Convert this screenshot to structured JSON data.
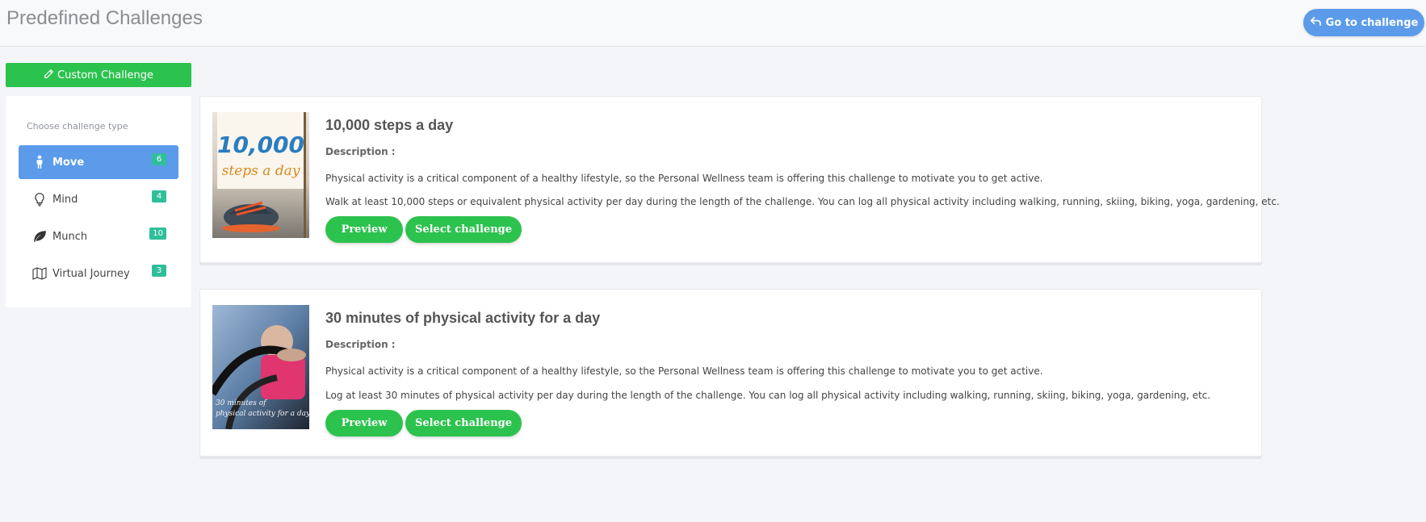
{
  "header": {
    "title": "Predefined Challenges",
    "goto_label": "Go to challenge"
  },
  "custom_challenge_label": "Custom Challenge",
  "sidebar": {
    "heading": "Choose challenge type",
    "items": [
      {
        "label": "Move",
        "count": "6",
        "icon": "person-icon",
        "active": true
      },
      {
        "label": "Mind",
        "count": "4",
        "icon": "lightbulb-icon",
        "active": false
      },
      {
        "label": "Munch",
        "count": "10",
        "icon": "leaf-icon",
        "active": false
      },
      {
        "label": "Virtual Journey",
        "count": "3",
        "icon": "map-icon",
        "active": false
      }
    ]
  },
  "challenges": [
    {
      "title": "10,000 steps a day",
      "desc_label": "Description :",
      "line1": "Physical activity is a critical component of a healthy lifestyle, so the Personal Wellness team is offering this challenge to motivate you to get active.",
      "line2": "Walk at least 10,000 steps or equivalent physical activity per day during the length of the challenge. You can log all physical activity including walking, running, skiing, biking, yoga, gardening, etc.",
      "image_text_1": "10,000",
      "image_text_2": "steps a day",
      "preview_label": "Preview",
      "select_label": "Select challenge"
    },
    {
      "title": "30 minutes of physical activity for a day",
      "desc_label": "Description :",
      "line1": "Physical activity is a critical component of a healthy lifestyle, so the Personal Wellness team is offering this challenge to motivate you to get active.",
      "line2": "Log at least 30 minutes of physical activity per day during the length of the challenge. You can log all physical activity including walking, running, skiing, biking, yoga, gardening, etc.",
      "image_text_1": "30 minutes of",
      "image_text_2": "physical activity for a day",
      "preview_label": "Preview",
      "select_label": "Select challenge"
    }
  ],
  "colors": {
    "primary_blue": "#5b9bea",
    "green": "#2cc24e",
    "badge_teal": "#2fbf9a"
  }
}
